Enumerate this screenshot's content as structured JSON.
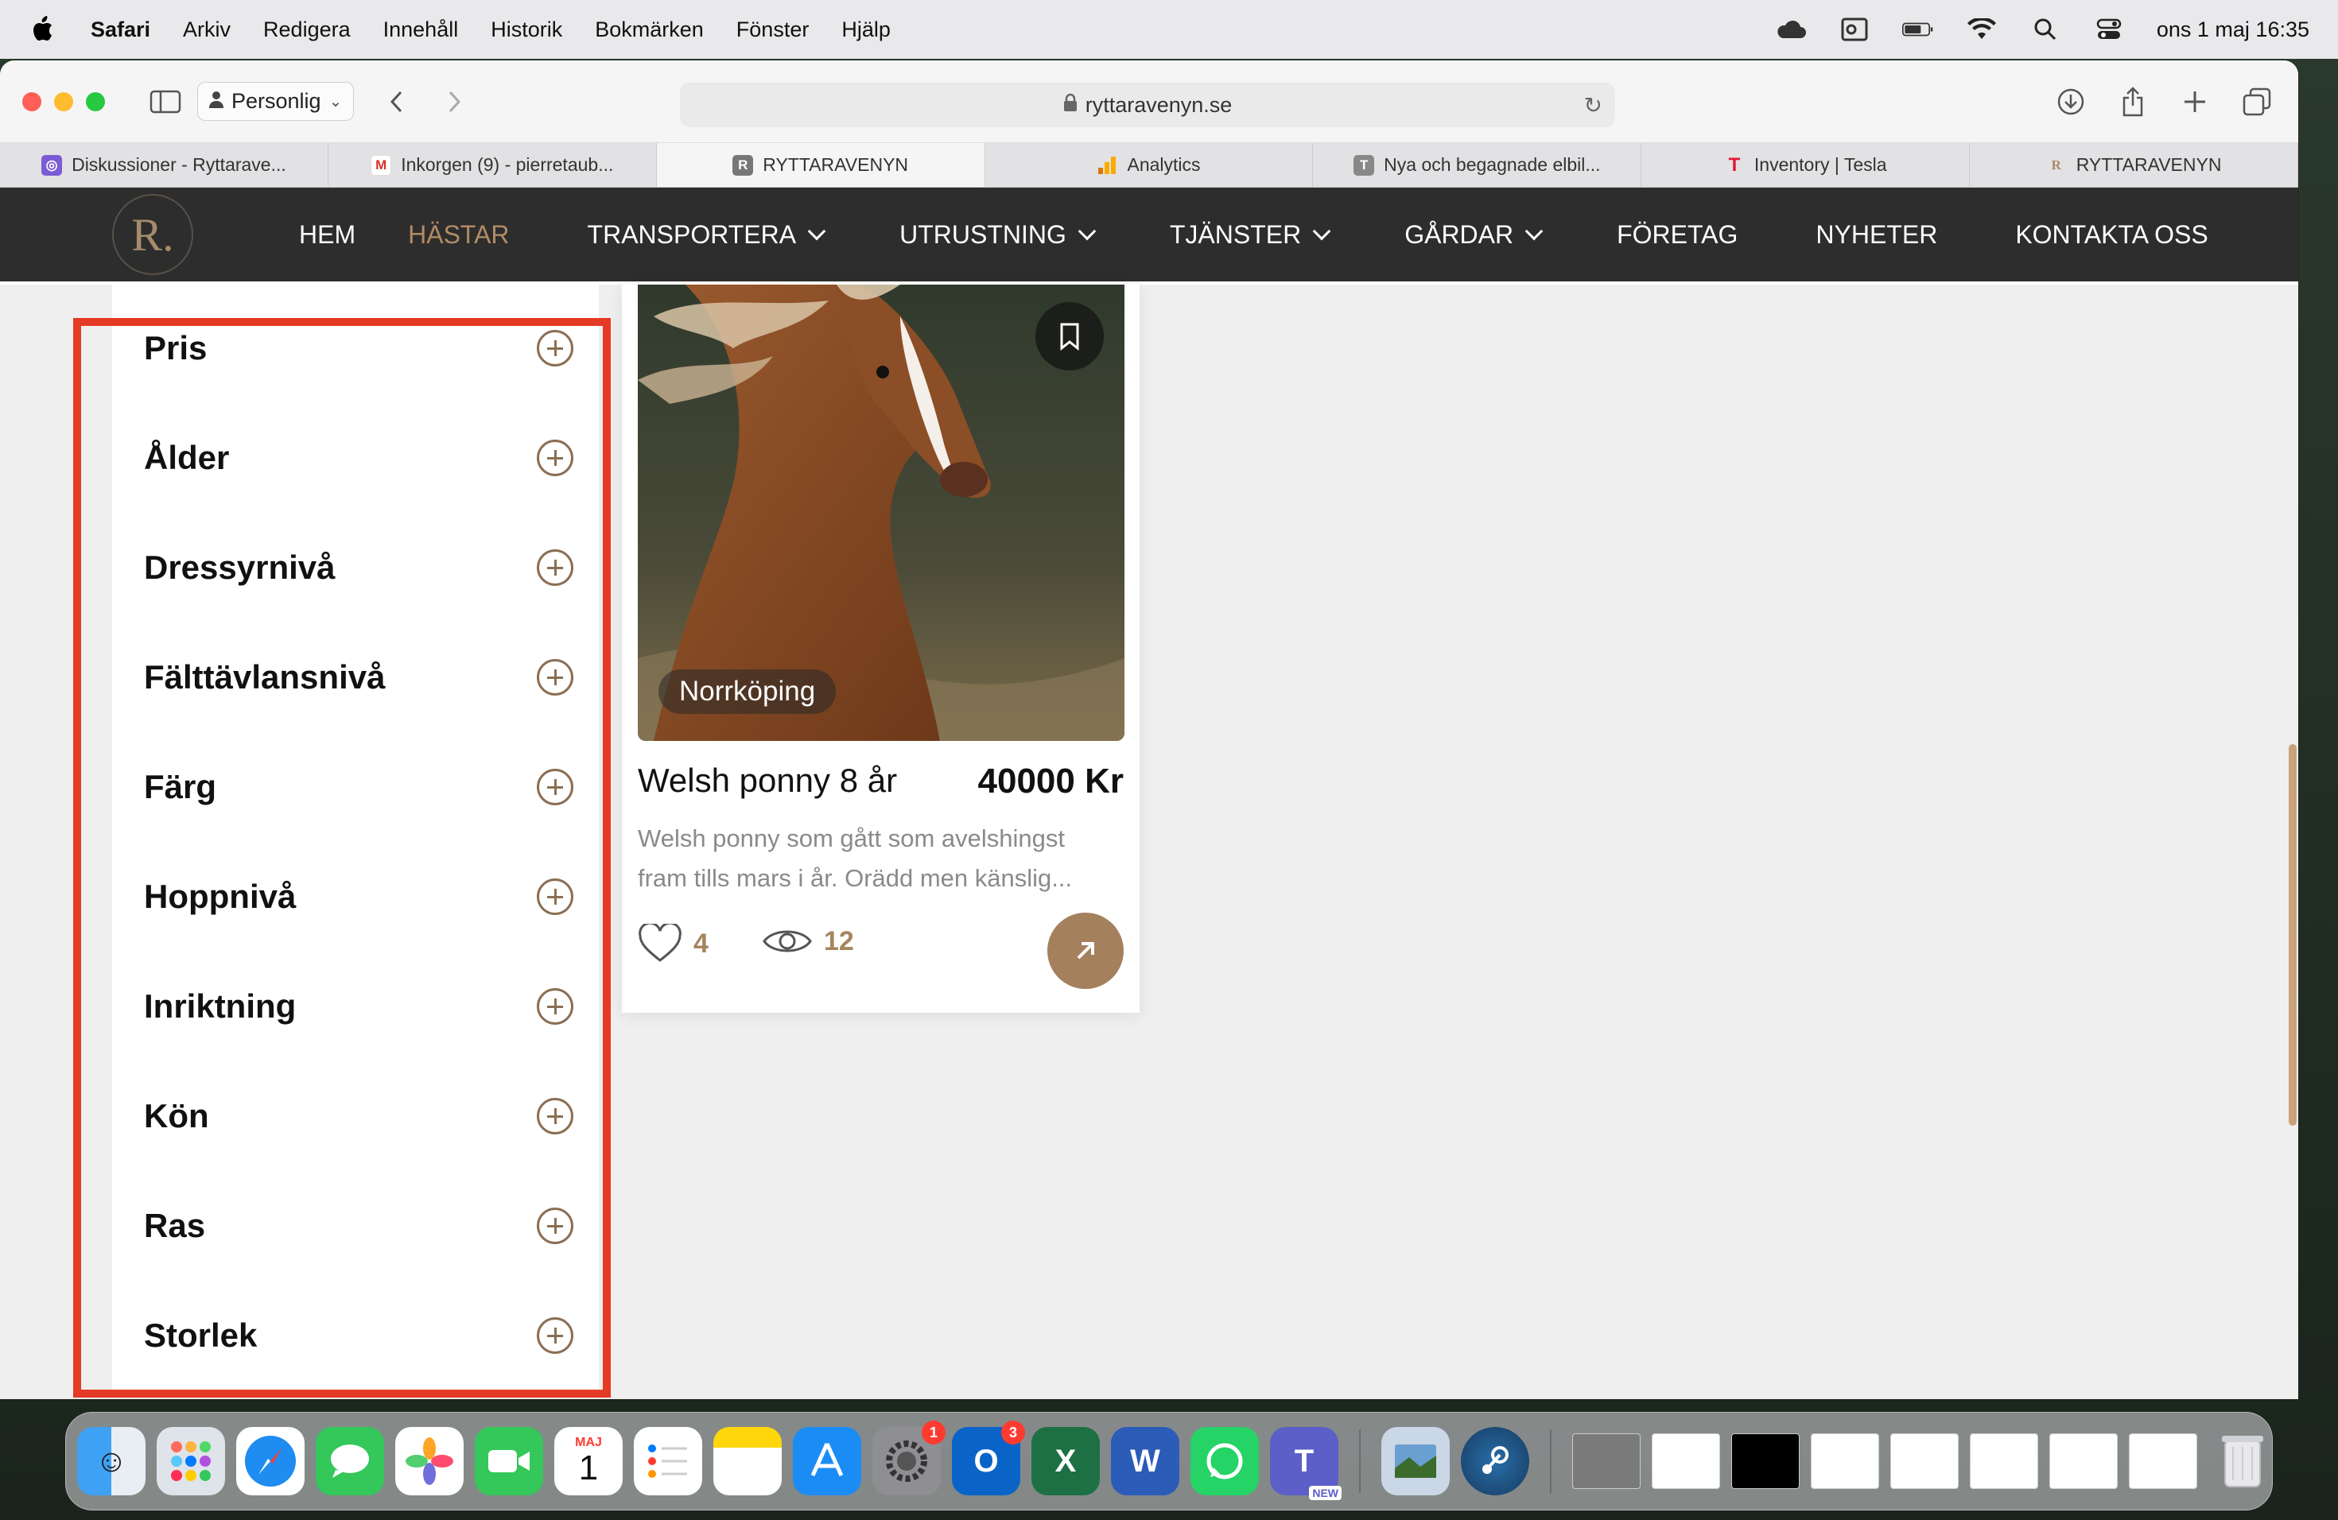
{
  "menubar": {
    "app_name": "Safari",
    "items": [
      "Arkiv",
      "Redigera",
      "Innehåll",
      "Historik",
      "Bokmärken",
      "Fönster",
      "Hjälp"
    ],
    "clock": "ons 1 maj 16:35"
  },
  "browser": {
    "profile": "Personlig",
    "url": "ryttaravenyn.se",
    "tabs": [
      {
        "label": "Diskussioner - Ryttarave...",
        "icon": "forum-icon"
      },
      {
        "label": "Inkorgen (9) - pierretaub...",
        "icon": "gmail-icon"
      },
      {
        "label": "RYTTARAVENYN",
        "icon": "r-favicon",
        "active": true
      },
      {
        "label": "Analytics",
        "icon": "analytics-icon"
      },
      {
        "label": "Nya och begagnade elbil...",
        "icon": "t-favicon"
      },
      {
        "label": "Inventory | Tesla",
        "icon": "tesla-icon"
      },
      {
        "label": "RYTTARAVENYN",
        "icon": "r-favicon"
      }
    ]
  },
  "site": {
    "logo_letter": "R.",
    "nav": [
      {
        "label": "HEM",
        "dropdown": false
      },
      {
        "label": "HÄSTAR",
        "dropdown": false,
        "active": true
      },
      {
        "label": "TRANSPORTERA",
        "dropdown": true
      },
      {
        "label": "UTRUSTNING",
        "dropdown": true
      },
      {
        "label": "TJÄNSTER",
        "dropdown": true
      },
      {
        "label": "GÅRDAR",
        "dropdown": true
      },
      {
        "label": "FÖRETAG",
        "dropdown": false
      },
      {
        "label": "NYHETER",
        "dropdown": false
      },
      {
        "label": "KONTAKTA OSS",
        "dropdown": false
      }
    ]
  },
  "filters": [
    "Pris",
    "Ålder",
    "Dressyrnivå",
    "Fälttävlansnivå",
    "Färg",
    "Hoppnivå",
    "Inriktning",
    "Kön",
    "Ras",
    "Storlek"
  ],
  "listing": {
    "location": "Norrköping",
    "title": "Welsh ponny 8 år",
    "price": "40000 Kr",
    "description": "Welsh ponny som gått som avelshingst fram tills mars i år. Orädd men känslig...",
    "likes": "4",
    "views": "12"
  },
  "colors": {
    "accent": "#a5805c",
    "nav_bg": "#2d2d2d",
    "highlight": "#e53a25"
  },
  "dock": {
    "calendar_month": "MAJ",
    "calendar_day": "1",
    "settings_badge": "1",
    "outlook_badge": "3",
    "teams_tag": "NEW"
  }
}
